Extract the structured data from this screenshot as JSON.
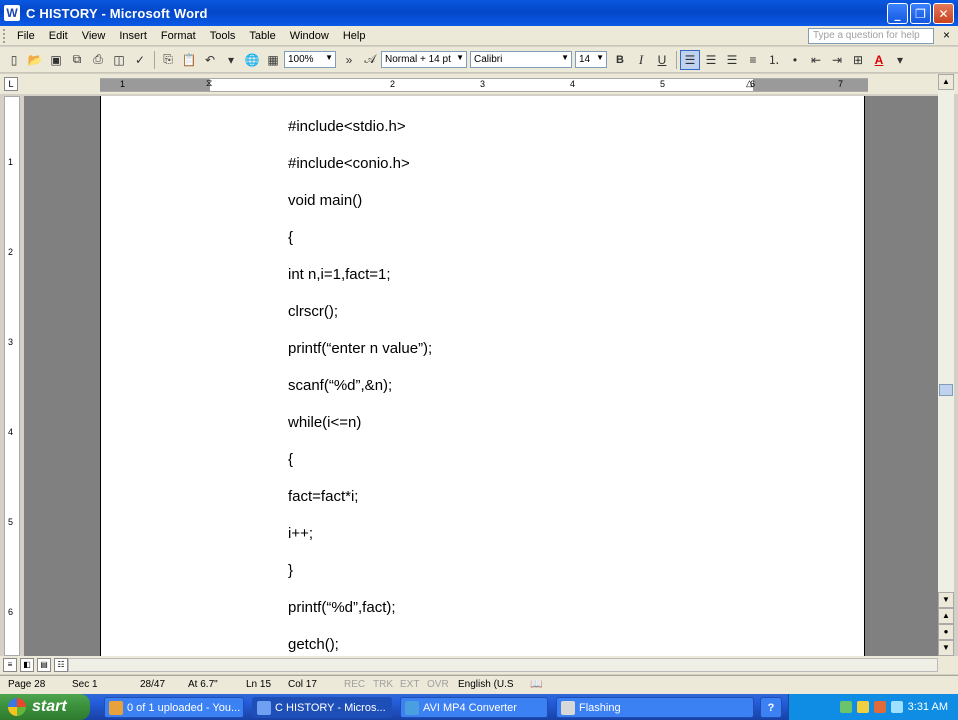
{
  "window": {
    "title": "C  HISTORY - Microsoft Word",
    "app_icon": "W"
  },
  "menu": {
    "items": [
      "File",
      "Edit",
      "View",
      "Insert",
      "Format",
      "Tools",
      "Table",
      "Window",
      "Help"
    ],
    "help_placeholder": "Type a question for help",
    "close_glyph": "×"
  },
  "toolbar": {
    "zoom": "100%",
    "style": "Normal + 14 pt",
    "font": "Calibri",
    "size": "14",
    "bold": "B",
    "italic": "I",
    "underline": "U",
    "font_color_glyph": "A"
  },
  "ruler": {
    "ticks": [
      "1",
      "2",
      "3",
      "4",
      "5",
      "6",
      "7"
    ]
  },
  "vruler": {
    "ticks": [
      "1",
      "2",
      "3",
      "4",
      "5",
      "6"
    ]
  },
  "document": {
    "lines": [
      "#include<stdio.h>",
      "#include<conio.h>",
      "void main()",
      "{",
      "int n,i=1,fact=1;",
      "clrscr();",
      "printf(“enter n value”);",
      "scanf(“%d”,&n);",
      "while(i<=n)",
      "{",
      "fact=fact*i;",
      "i++;",
      "}",
      "printf(“%d”,fact);",
      "getch();"
    ]
  },
  "status": {
    "page": "Page 28",
    "sec": "Sec 1",
    "pages": "28/47",
    "at": "At 6.7\"",
    "ln": "Ln 15",
    "col": "Col 17",
    "rec": "REC",
    "trk": "TRK",
    "ext": "EXT",
    "ovr": "OVR",
    "lang": "English (U.S"
  },
  "taskbar": {
    "start": "start",
    "tasks": [
      {
        "label": "0 of 1 uploaded - You...",
        "color": "#e9a13b"
      },
      {
        "label": "C  HISTORY - Micros...",
        "color": "#2f5fc9"
      },
      {
        "label": "AVI MP4 Converter",
        "color": "#4a9fe0"
      },
      {
        "label": "Flashing",
        "color": "#d8d8d8"
      }
    ],
    "help_glyph": "?",
    "time": "3:31 AM"
  }
}
